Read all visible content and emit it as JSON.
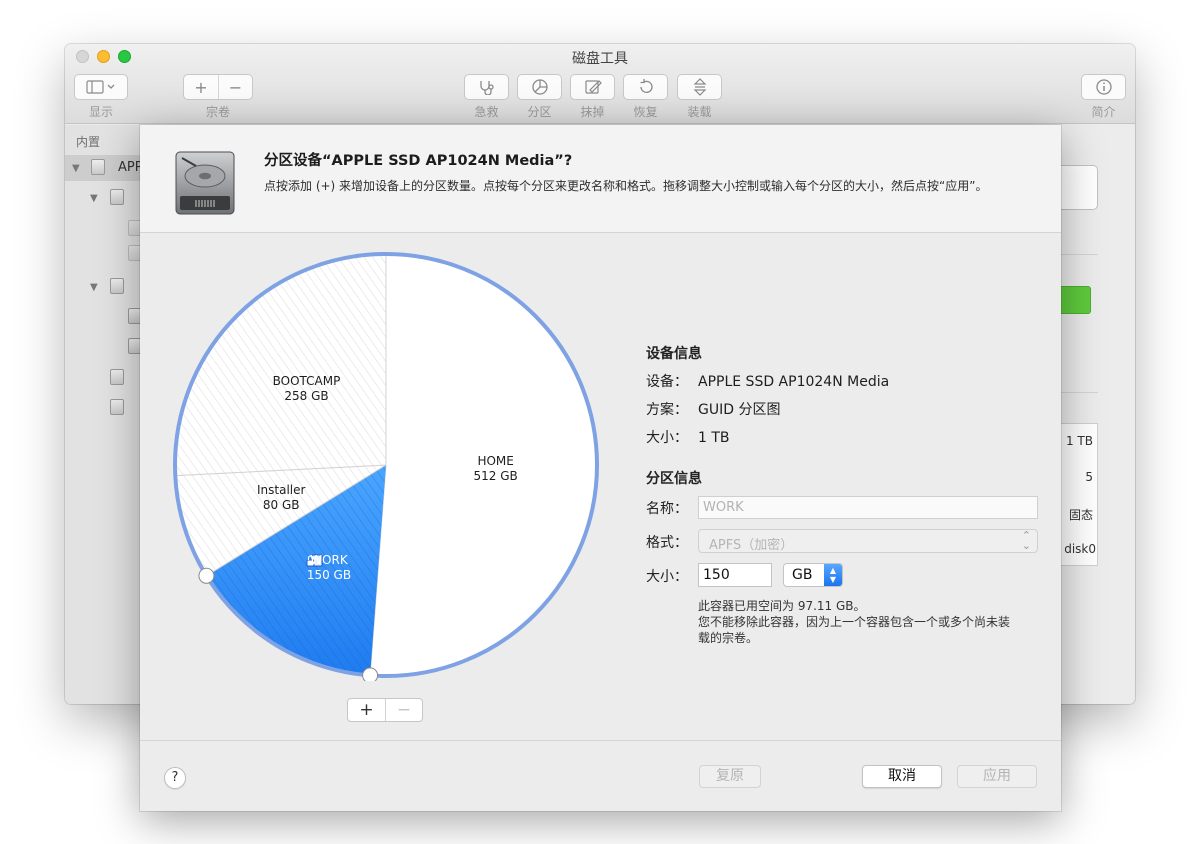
{
  "window": {
    "title": "磁盘工具",
    "toolbar": {
      "view_label": "显示",
      "volume_label": "宗卷",
      "volume_add": "+",
      "volume_remove": "−",
      "first_aid_label": "急救",
      "partition_label": "分区",
      "erase_label": "抹掉",
      "restore_label": "恢复",
      "mount_label": "装载",
      "info_label": "简介"
    },
    "sidebar": {
      "section_header": "内置",
      "selected_disk_label": "APPLE"
    },
    "right_panel": {
      "capacity": "1 TB",
      "child_count": "5",
      "type": "固态",
      "device": "disk0"
    }
  },
  "sheet": {
    "title": "分区设备“APPLE SSD AP1024N Media”?",
    "description": "点按添加 (+) 来增加设备上的分区数量。点按每个分区来更改名称和格式。拖移调整大小控制或输入每个分区的大小，然后点按“应用”。",
    "partitions": [
      {
        "name": "HOME",
        "size": "512 GB",
        "size_gb": 512,
        "selected": false,
        "hatched": false
      },
      {
        "name": "WORK",
        "size": "150 GB",
        "size_gb": 150,
        "selected": true,
        "hatched": true
      },
      {
        "name": "Installer",
        "size": "80 GB",
        "size_gb": 80,
        "selected": false,
        "hatched": true
      },
      {
        "name": "BOOTCAMP",
        "size": "258 GB",
        "size_gb": 258,
        "selected": false,
        "hatched": true
      }
    ],
    "add_partition": "+",
    "remove_partition": "−",
    "device_info": {
      "header": "设备信息",
      "device_key": "设备：",
      "device_value": "APPLE SSD AP1024N Media",
      "scheme_key": "方案：",
      "scheme_value": "GUID 分区图",
      "size_key": "大小：",
      "size_value": "1 TB"
    },
    "partition_info": {
      "header": "分区信息",
      "name_label": "名称：",
      "name_value": "WORK",
      "format_label": "格式：",
      "format_value": "APFS（加密）",
      "size_label": "大小：",
      "size_value": "150",
      "size_unit": "GB",
      "note_used": "此容器已用空间为 97.11 GB。",
      "note_cannot_remove_1": "您不能移除此容器，因为上一个容器包含一个或多个尚未装",
      "note_cannot_remove_2": "载的宗卷。"
    },
    "footer": {
      "help": "?",
      "revert": "复原",
      "cancel": "取消",
      "apply": "应用"
    }
  },
  "colors": {
    "accent_blue": "#2f8cf5",
    "pie_outline": "#7ea2e4",
    "traffic_min": "#fdbd2f",
    "traffic_max": "#28c840",
    "status_green": "#5fcb3d"
  }
}
